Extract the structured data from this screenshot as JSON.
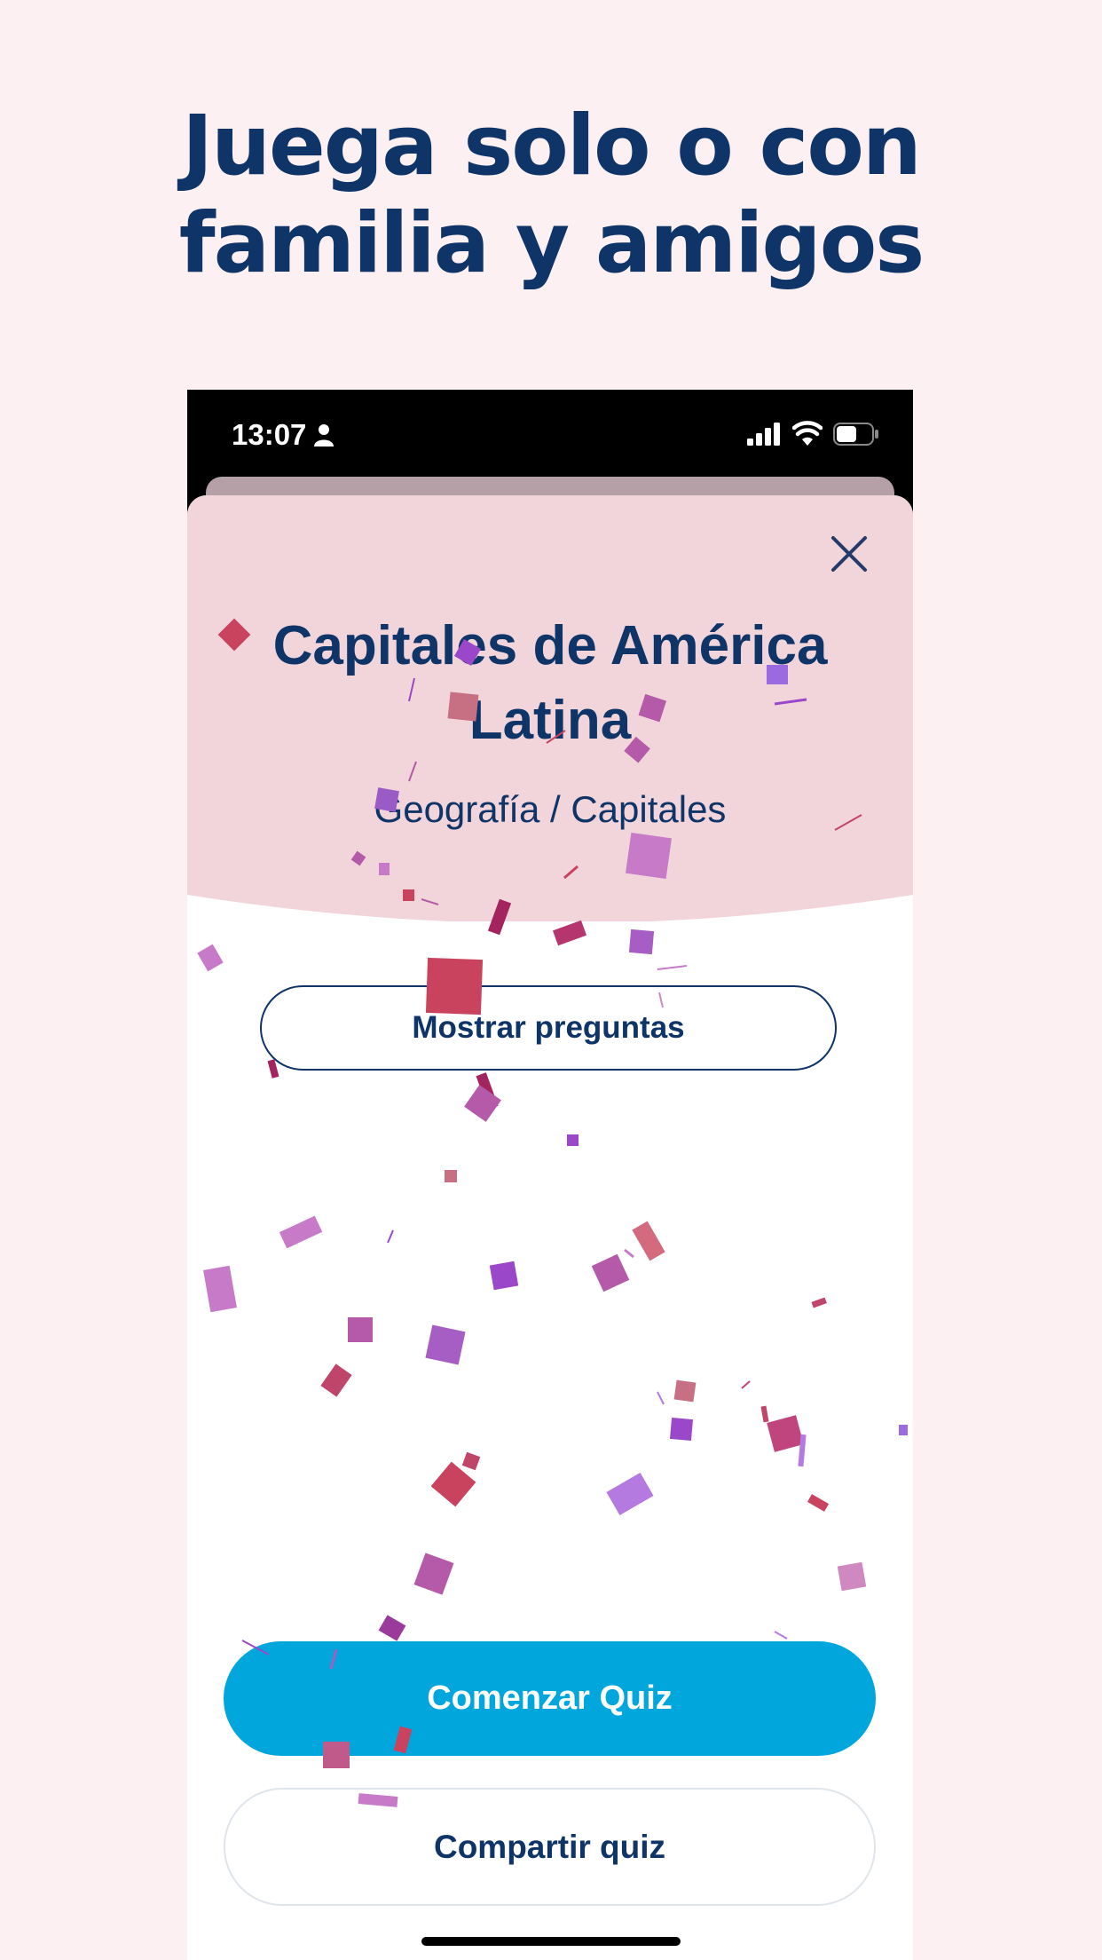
{
  "headline": {
    "line1": "Juega solo o con",
    "line2": "familia y amigos"
  },
  "status_bar": {
    "time": "13:07",
    "icons": [
      "person-icon",
      "cellular-signal-icon",
      "wifi-icon",
      "battery-icon"
    ]
  },
  "quiz": {
    "title_line1": "Capitales de América",
    "title_line2": "Latina",
    "category": "Geografía / Capitales"
  },
  "buttons": {
    "close_icon": "close-icon",
    "show_questions": "Mostrar preguntas",
    "start": "Comenzar Quiz",
    "share": "Compartir quiz"
  },
  "colors": {
    "background": "#fcf0f3",
    "header_pink": "#f2d5da",
    "navy": "#0e3468",
    "primary": "#00a6dc",
    "confetti": [
      "#c9435f",
      "#b55aa8",
      "#9b47c9",
      "#c77ac8",
      "#a3245e",
      "#b94f8c"
    ]
  }
}
